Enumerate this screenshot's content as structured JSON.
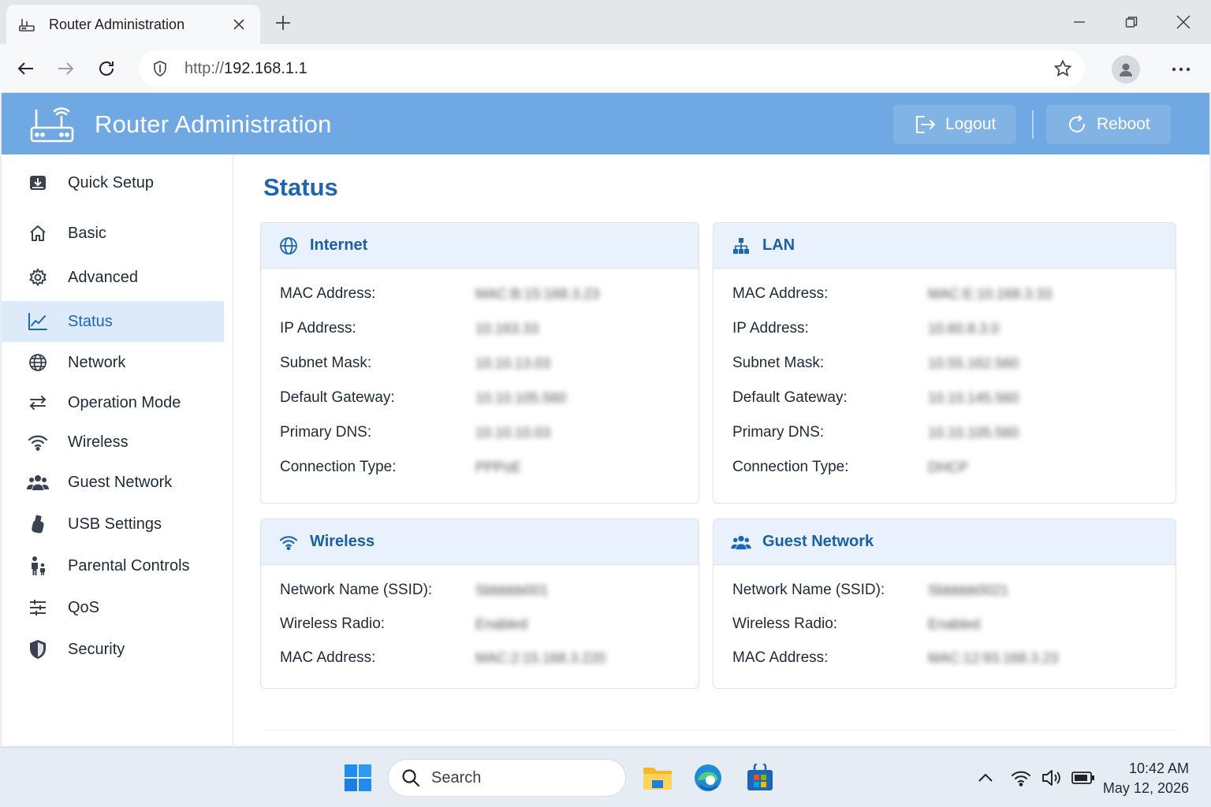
{
  "browser": {
    "tab_title": "Router Administration",
    "url_protocol": "http://",
    "url_host": "192.168.1.1"
  },
  "app": {
    "title": "Router Administration",
    "logout_label": "Logout",
    "reboot_label": "Reboot",
    "accent_color": "#6fa8e2"
  },
  "sidebar": {
    "items": [
      {
        "label": "Quick Setup",
        "icon": "quick-setup-icon"
      },
      {
        "label": "Basic",
        "icon": "home-icon"
      },
      {
        "label": "Advanced",
        "icon": "gear-icon"
      },
      {
        "label": "Status",
        "icon": "chart-icon",
        "active": true
      },
      {
        "label": "Network",
        "icon": "globe-icon"
      },
      {
        "label": "Operation Mode",
        "icon": "swap-icon"
      },
      {
        "label": "Wireless",
        "icon": "wifi-icon"
      },
      {
        "label": "Guest Network",
        "icon": "users-icon"
      },
      {
        "label": "USB Settings",
        "icon": "usb-icon"
      },
      {
        "label": "Parental Controls",
        "icon": "parental-icon"
      },
      {
        "label": "QoS",
        "icon": "sliders-icon"
      },
      {
        "label": "Security",
        "icon": "shield-icon"
      }
    ]
  },
  "main": {
    "page_title": "Status",
    "internet": {
      "title": "Internet",
      "rows": [
        {
          "label": "MAC Address:",
          "value": "MAC:B:15:168.3.23"
        },
        {
          "label": "IP Address:",
          "value": "10.163.33"
        },
        {
          "label": "Subnet Mask:",
          "value": "10.10.13.03"
        },
        {
          "label": "Default Gateway:",
          "value": "10.10.105.560"
        },
        {
          "label": "Primary DNS:",
          "value": "10.10.10.03"
        },
        {
          "label": "Connection Type:",
          "value": "PPPoE"
        }
      ]
    },
    "lan": {
      "title": "LAN",
      "rows": [
        {
          "label": "MAC Address:",
          "value": "MAC:E:10.168.3.33"
        },
        {
          "label": "IP Address:",
          "value": "10.60.8.3.0"
        },
        {
          "label": "Subnet Mask:",
          "value": "10.55.162.560"
        },
        {
          "label": "Default Gateway:",
          "value": "10.10.145.560"
        },
        {
          "label": "Primary DNS:",
          "value": "10.10.105.560"
        },
        {
          "label": "Connection Type:",
          "value": "DHCP"
        }
      ]
    },
    "wireless": {
      "title": "Wireless",
      "rows": [
        {
          "label": "Network Name (SSID):",
          "value": "Sbbbbb001"
        },
        {
          "label": "Wireless Radio:",
          "value": "Enabled"
        },
        {
          "label": "MAC Address:",
          "value": "MAC:2:15.168.3.220"
        }
      ]
    },
    "guest": {
      "title": "Guest Network",
      "rows": [
        {
          "label": "Network Name (SSID):",
          "value": "Sbbbbb0021"
        },
        {
          "label": "Wireless Radio:",
          "value": "Enabled"
        },
        {
          "label": "MAC Address:",
          "value": "MAC:12:93.168.3.23"
        }
      ]
    }
  },
  "taskbar": {
    "search_placeholder": "Search",
    "time": "10:42 AM",
    "date": "May 12, 2026"
  }
}
